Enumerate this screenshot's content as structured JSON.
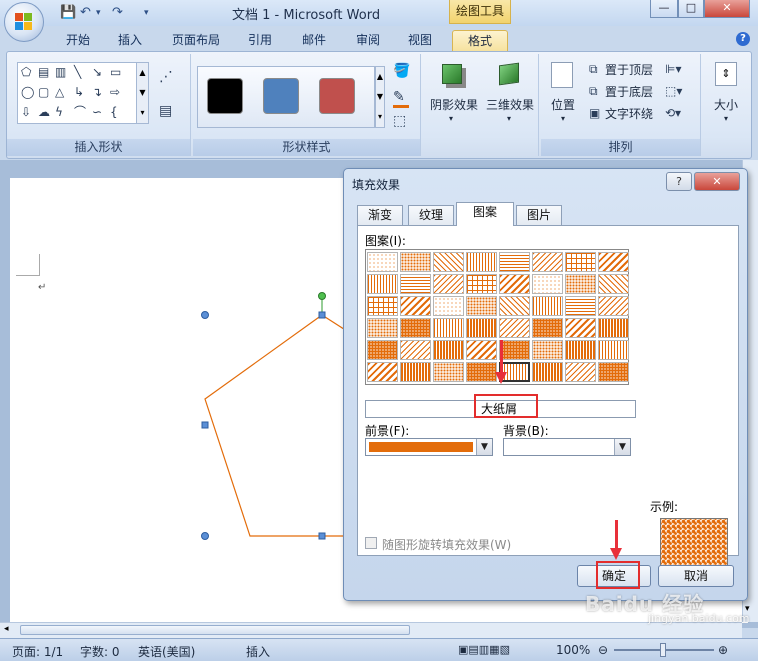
{
  "window": {
    "title": "文档 1 - Microsoft Word",
    "context_tab_group": "绘图工具"
  },
  "ribbon": {
    "tabs": [
      "开始",
      "插入",
      "页面布局",
      "引用",
      "邮件",
      "审阅",
      "视图",
      "格式"
    ],
    "active_tab": "格式",
    "groups": {
      "insert_shapes": "插入形状",
      "shape_styles": "形状样式",
      "arrange": "排列"
    },
    "buttons": {
      "shadow_effect": "阴影效果",
      "3d_effect": "三维效果",
      "position": "位置",
      "bring_to_front": "置于顶层",
      "send_to_back": "置于底层",
      "text_wrap": "文字环绕",
      "size": "大小"
    },
    "style_swatch_colors": [
      "#000000",
      "#4f81bd",
      "#c0504d"
    ]
  },
  "dialog": {
    "title": "填充效果",
    "tabs": [
      "渐变",
      "纹理",
      "图案",
      "图片"
    ],
    "active_tab": "图案",
    "pattern_label": "图案(I):",
    "selected_pattern_name": "大纸屑",
    "foreground_label": "前景(F):",
    "background_label": "背景(B):",
    "foreground_color": "#e36c0a",
    "sample_label": "示例:",
    "rotate_checkbox_label": "随图形旋转填充效果(W)",
    "ok_label": "确定",
    "cancel_label": "取消"
  },
  "status": {
    "page": "页面: 1/1",
    "words": "字数: 0",
    "language": "英语(美国)",
    "mode": "插入",
    "zoom": "100%"
  },
  "watermark": {
    "brand": "Baidu 经验",
    "url": "jingyan.baidu.com"
  }
}
